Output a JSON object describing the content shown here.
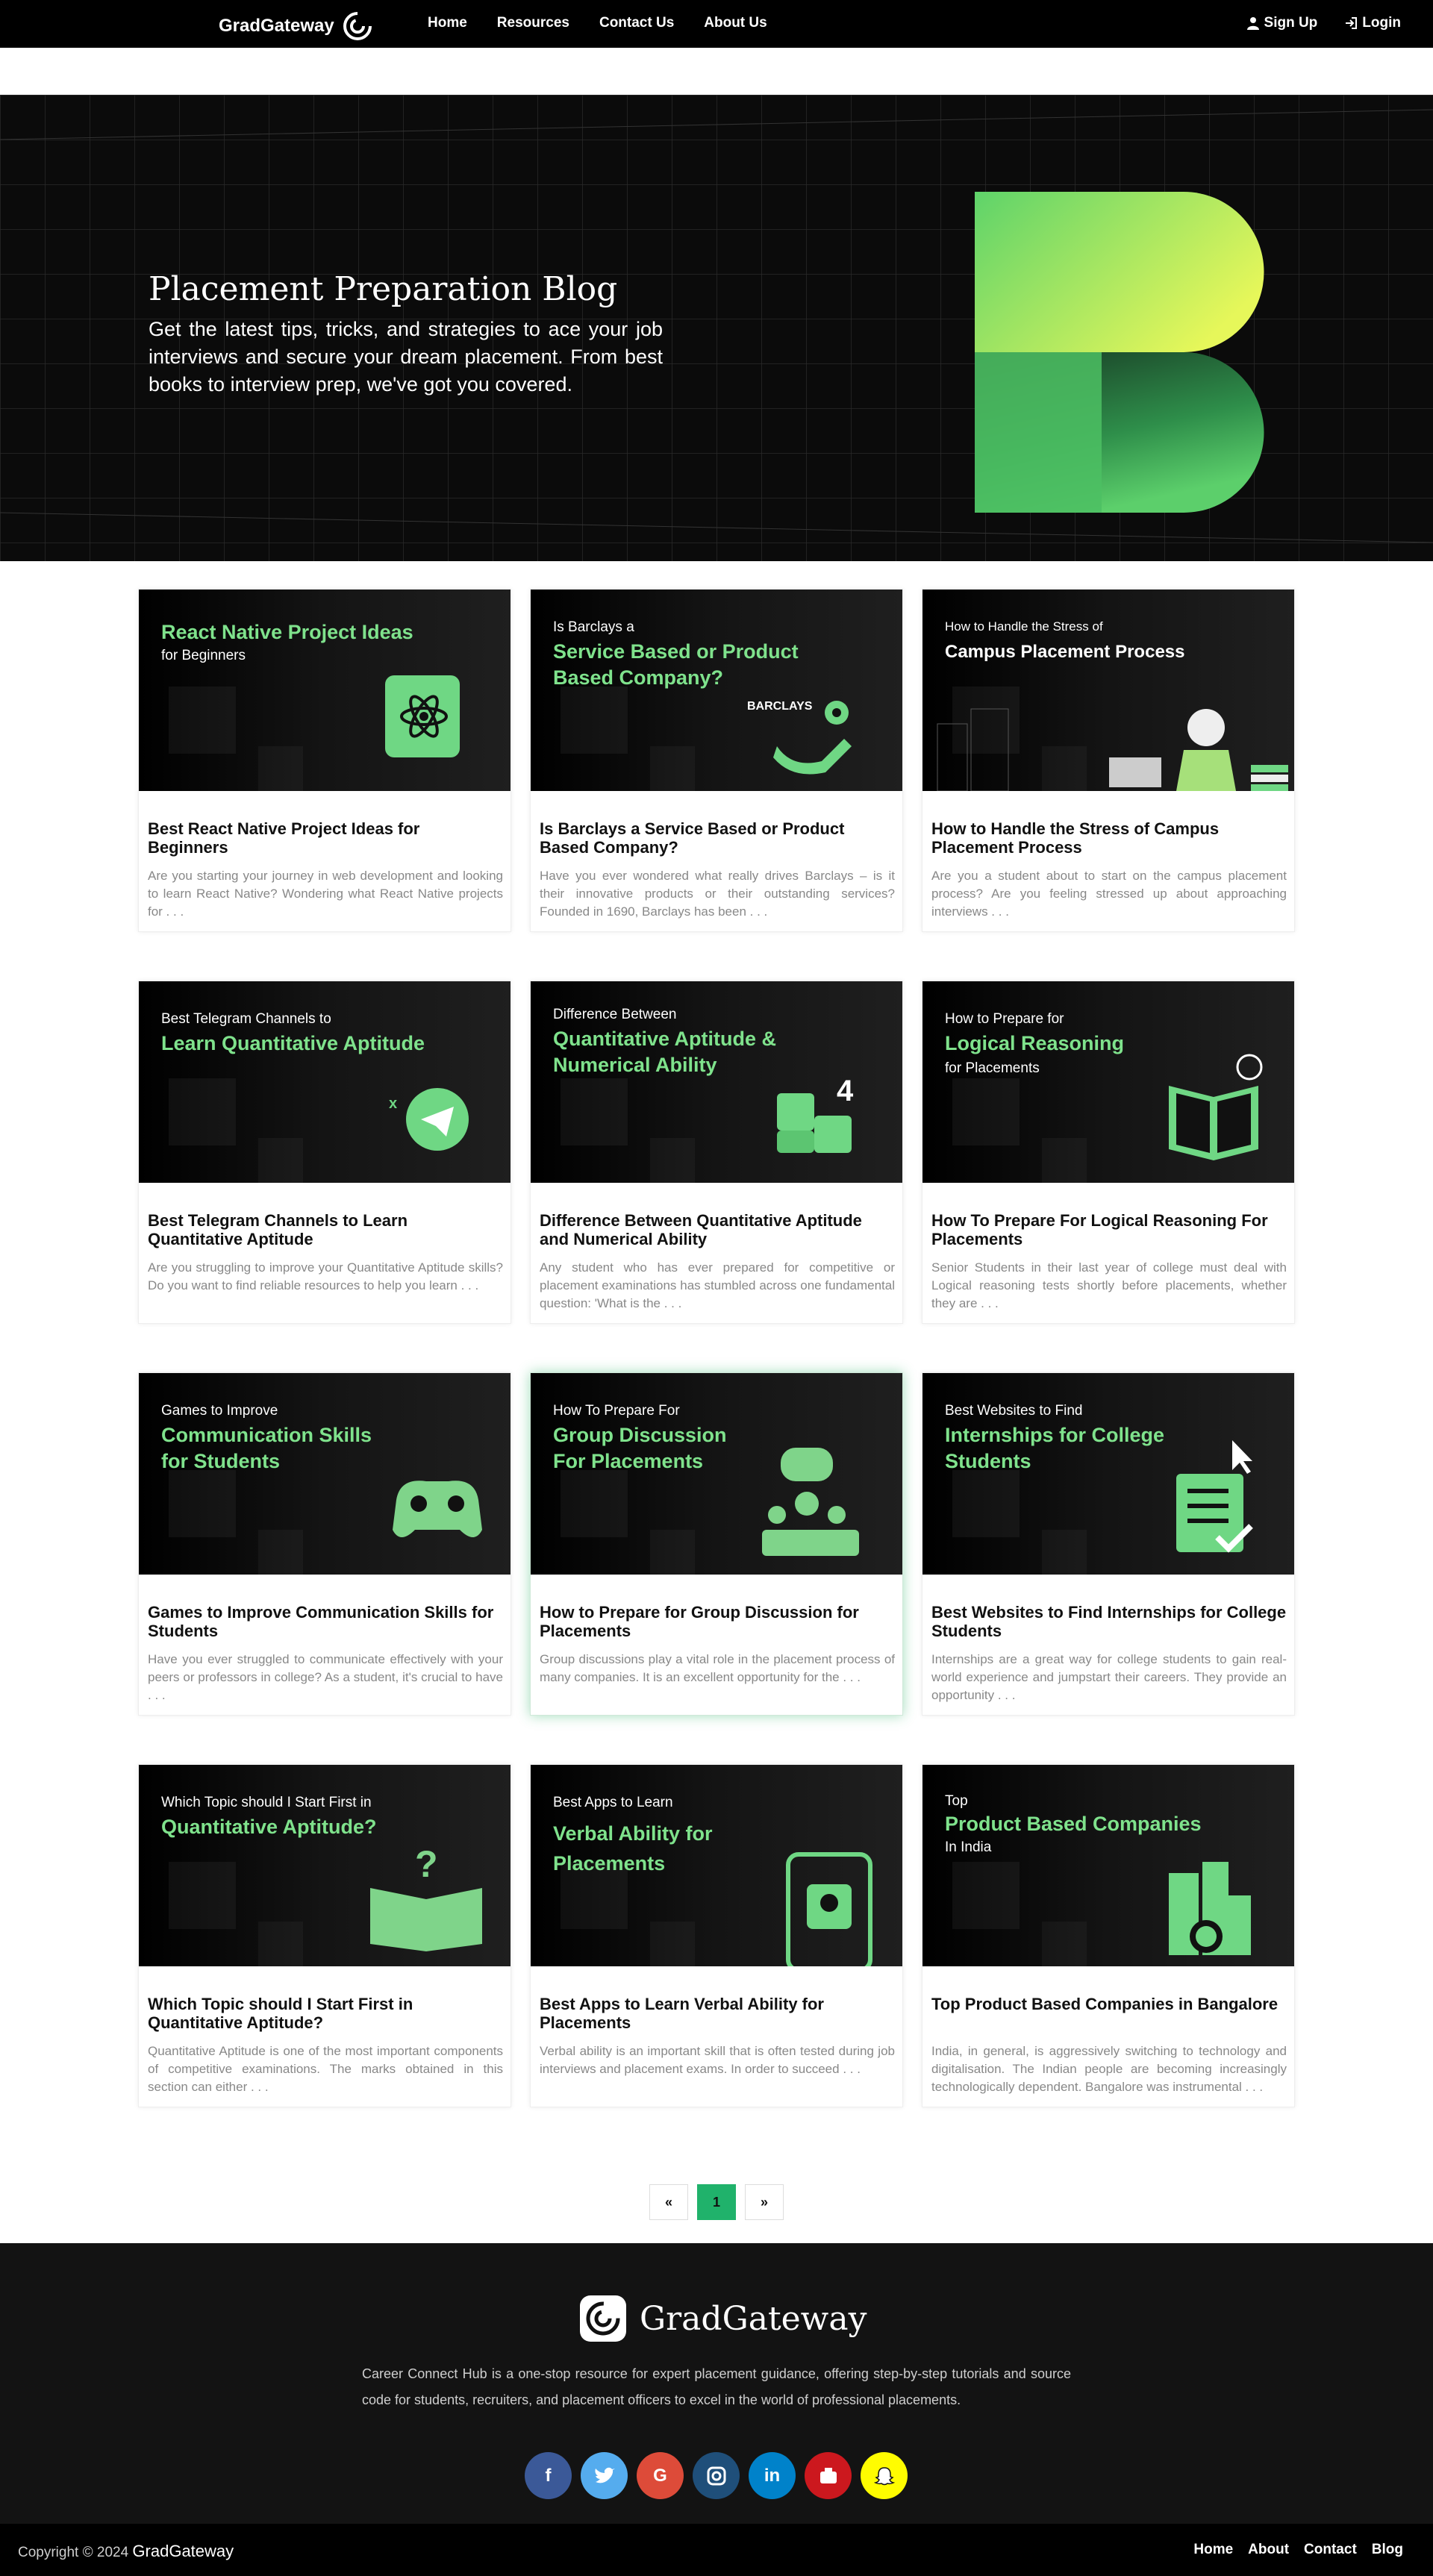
{
  "nav": {
    "brand": "GradGateway",
    "links": [
      "Home",
      "Resources",
      "Contact Us",
      "About Us"
    ],
    "signup": "Sign Up",
    "login": "Login"
  },
  "hero": {
    "title": "Placement Preparation Blog",
    "description": "Get the latest tips, tricks, and strategies to ace your job interviews and secure your dream placement. From best books to interview prep, we've got you covered."
  },
  "posts": [
    {
      "thumb": {
        "line1": "",
        "green": "React Native Project Ideas",
        "line3": "for Beginners"
      },
      "title": "Best React Native Project Ideas for Beginners",
      "excerpt": "Are you starting your journey in web development and looking to learn React Native? Wondering what React Native projects for . . ."
    },
    {
      "thumb": {
        "line1": "Is Barclays a",
        "green": "Service Based or Product Based Company?",
        "line3": "",
        "badge": "BARCLAYS"
      },
      "title": "Is Barclays a Service Based or Product Based Company?",
      "excerpt": "Have you ever wondered what really drives Barclays – is it their innovative products or their outstanding services? Founded in 1690, Barclays has been . . ."
    },
    {
      "thumb": {
        "line1": "How to Handle the Stress of",
        "green": "Campus Placement Process",
        "line3": ""
      },
      "title": "How to Handle the Stress of Campus Placement Process",
      "excerpt": "Are you a student about to start on the campus placement process? Are you feeling stressed up about approaching interviews . . ."
    },
    {
      "thumb": {
        "line1": "Best Telegram Channels to",
        "green": "Learn Quantitative Aptitude",
        "line3": ""
      },
      "title": "Best Telegram Channels to Learn Quantitative Aptitude",
      "excerpt": "Are you struggling to improve your Quantitative Aptitude skills? Do you want to find reliable resources to help you learn . . ."
    },
    {
      "thumb": {
        "line1": "Difference Between",
        "green": "Quantitative Aptitude & Numerical Ability",
        "line3": ""
      },
      "title": "Difference Between Quantitative Aptitude and Numerical Ability",
      "excerpt": "Any student who has ever prepared for competitive or placement examinations has stumbled across one fundamental question: 'What is the . . ."
    },
    {
      "thumb": {
        "line1": "How to Prepare for",
        "green": "Logical Reasoning",
        "line3": "for Placements"
      },
      "title": "How To Prepare For Logical Reasoning For Placements",
      "excerpt": "Senior Students in their last year of college must deal with Logical reasoning tests shortly before placements, whether they are . . ."
    },
    {
      "thumb": {
        "line1": "Games to Improve",
        "green": "Communication Skills for Students",
        "line3": ""
      },
      "title": "Games to Improve Communication Skills for Students",
      "excerpt": "Have you ever struggled to communicate effectively with your peers or professors in college? As a student, it's crucial to have . . ."
    },
    {
      "thumb": {
        "line1": "How To Prepare For",
        "green": "Group Discussion For Placements",
        "line3": ""
      },
      "title": "How to Prepare for Group Discussion for Placements",
      "excerpt": "Group discussions play a vital role in the placement process of many companies. It is an excellent opportunity for the . . ."
    },
    {
      "thumb": {
        "line1": "Best Websites to Find",
        "green": "Internships for College Students",
        "line3": ""
      },
      "title": "Best Websites to Find Internships for College Students",
      "excerpt": "Internships are a great way for college students to gain real-world experience and jumpstart their careers. They provide an opportunity . . ."
    },
    {
      "thumb": {
        "line1": "Which Topic should I Start First in",
        "green": "Quantitative Aptitude?",
        "line3": ""
      },
      "title": "Which Topic should I Start First in Quantitative Aptitude?",
      "excerpt": "Quantitative Aptitude is one of the most important components of competitive examinations. The marks obtained in this section can either . . ."
    },
    {
      "thumb": {
        "line1": "Best Apps to Learn",
        "green": "Verbal Ability for Placements",
        "line3": ""
      },
      "title": "Best Apps to Learn Verbal Ability for Placements",
      "excerpt": "Verbal ability is an important skill that is often tested during job interviews and placement exams. In order to succeed . . ."
    },
    {
      "thumb": {
        "line1": "Top",
        "green": "Product Based Companies",
        "line3": "In India"
      },
      "title": "Top Product Based Companies in Bangalore",
      "excerpt": "India, in general, is aggressively switching to technology and digitalisation. The Indian people are becoming increasingly technologically dependent. Bangalore was instrumental . . ."
    }
  ],
  "pagination": {
    "prev": "«",
    "current": "1",
    "next": "»"
  },
  "footer": {
    "brand": "GradGateway",
    "description": "Career Connect Hub is a one-stop resource for expert placement guidance, offering step-by-step tutorials and source code for students, recruiters, and placement officers to excel in the world of professional placements.",
    "copyright": "Copyright © 2024",
    "copyright_brand": "GradGateway",
    "links": [
      "Home",
      "About",
      "Contact",
      "Blog"
    ]
  },
  "colors": {
    "accent": "#7fe28c",
    "pager_active": "#20b26b"
  }
}
